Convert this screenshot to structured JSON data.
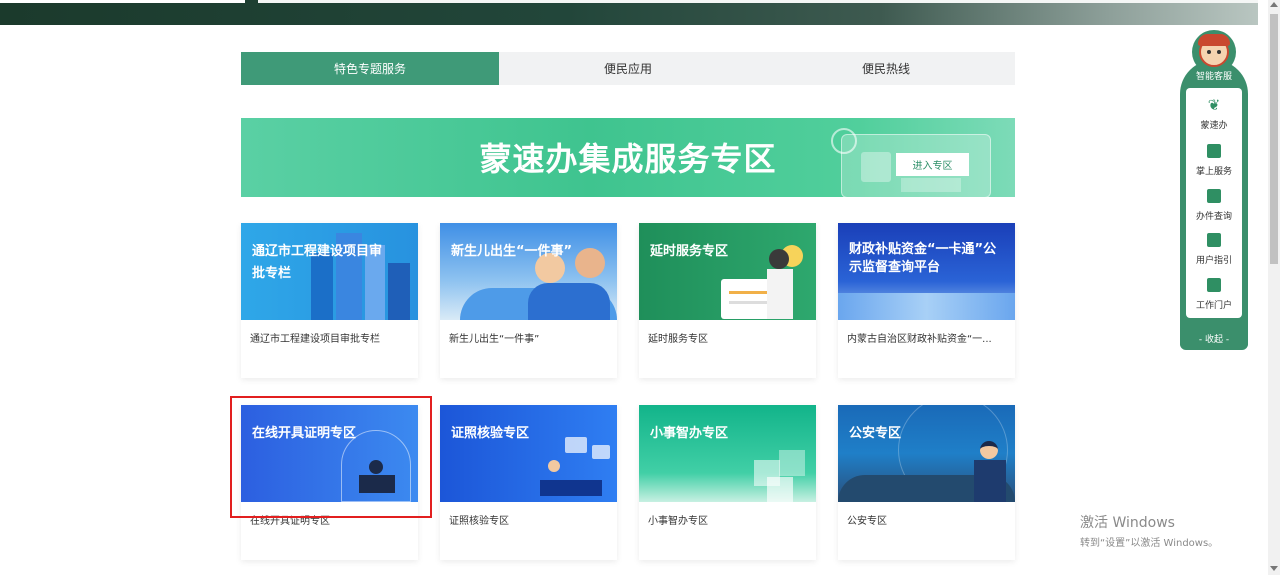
{
  "tabs": [
    {
      "label": "特色专题服务",
      "active": true
    },
    {
      "label": "便民应用",
      "active": false
    },
    {
      "label": "便民热线",
      "active": false
    }
  ],
  "banner": {
    "title": "蒙速办集成服务专区",
    "button_label": "进入专区"
  },
  "cards": [
    {
      "thumb_title": "通辽市工程建设项目审批专栏",
      "label": "通辽市工程建设项目审批专栏"
    },
    {
      "thumb_title": "新生儿出生“一件事”",
      "label": "新生儿出生“一件事”"
    },
    {
      "thumb_title": "延时服务专区",
      "label": "延时服务专区"
    },
    {
      "thumb_title": "财政补贴资金“一卡通”公示监督查询平台",
      "label": "内蒙古自治区财政补贴资金“一..."
    },
    {
      "thumb_title": "在线开具证明专区",
      "label": "在线开具证明专区"
    },
    {
      "thumb_title": "证照核验专区",
      "label": "证照核验专区"
    },
    {
      "thumb_title": "小事智办专区",
      "label": "小事智办专区"
    },
    {
      "thumb_title": "公安专区",
      "label": "公安专区"
    }
  ],
  "sidebar": {
    "title": "智能客服",
    "items": [
      {
        "label": "蒙速办",
        "icon": "mengsuban-logo-icon"
      },
      {
        "label": "掌上服务",
        "icon": "mobile-service-icon"
      },
      {
        "label": "办件查询",
        "icon": "document-search-icon"
      },
      {
        "label": "用户指引",
        "icon": "guide-icon"
      },
      {
        "label": "工作门户",
        "icon": "portal-icon"
      }
    ],
    "collapse_label": "- 收起 -"
  },
  "watermark": {
    "line1": "激活 Windows",
    "line2": "转到“设置”以激活 Windows。"
  },
  "colors": {
    "accent": "#3f9a78",
    "highlight_border": "#e21f1f"
  }
}
